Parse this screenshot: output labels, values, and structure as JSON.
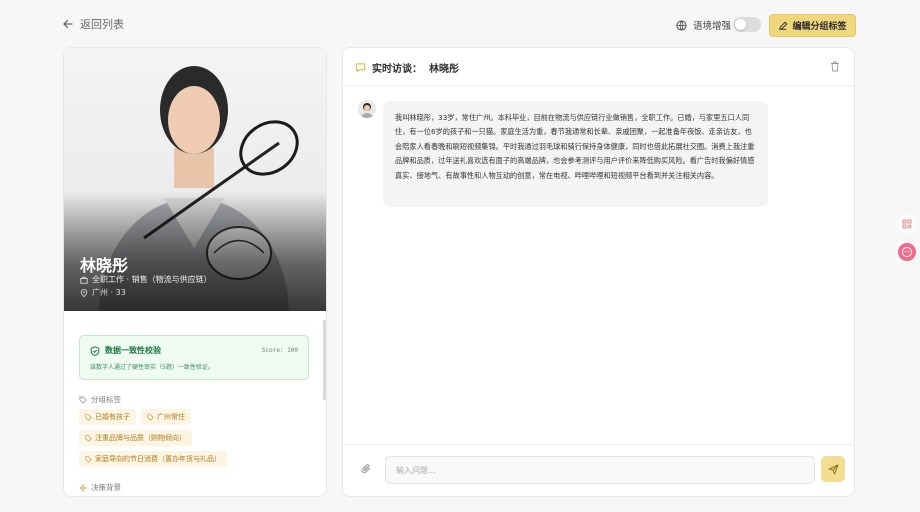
{
  "topbar": {
    "back_label": "返回列表",
    "lang_label": "语境增强",
    "edit_label": "编辑分组标签"
  },
  "profile": {
    "name": "林晓彤",
    "job": "全职工作 · 销售（物流与供应链）",
    "location": "广州 · 33"
  },
  "verify": {
    "title": "数据一致性校验",
    "score": "Score: 100",
    "desc": "该数字人通过了硬性审实（5题）一致性验证。"
  },
  "groups": {
    "label": "分组标签",
    "tags": [
      "已婚有孩子",
      "广州常住",
      "注重品牌与品质（购物倾向）",
      "家庭导向的节日消费（置办年货与礼品）"
    ]
  },
  "decision": {
    "label": "决策背景"
  },
  "chat": {
    "title": "实时访谈：  林晓彤",
    "message": "我叫林晓彤，33岁，常住广州。本科毕业，目前在物流与供应链行业做销售，全职工作。已婚，与家里五口人同住，有一位6岁的孩子和一只猫。家庭生活为重，春节我通常和长辈、亲戚团聚，一起准备年夜饭、走亲访友，也会陪家人看春晚和刷短视频集锦。平时我通过羽毛球和骑行保持身体健康，同时也借此拓展社交圈。消费上我注重品牌和品质，过年送礼喜欢选有面子的高端品牌，也会参考测评与用户评价来降低购买风险。看广告时我偏好情感真实、接地气、有故事性和人物互动的创意，常在电视、哔哩哔哩和短视频平台看到并关注相关内容。",
    "placeholder": "输入问题..."
  },
  "icons": {
    "back": "arrow-left-icon",
    "globe": "globe-icon",
    "pencil": "pencil-icon",
    "shield": "shield-check-icon",
    "tag": "tag-icon",
    "chat": "chat-icon",
    "trash": "trash-icon",
    "clip": "paperclip-icon",
    "send": "send-icon",
    "briefcase": "briefcase-icon",
    "pin": "location-pin-icon"
  },
  "colors": {
    "accent": "#f0d77e",
    "success": "#1f7a45",
    "tag_text": "#b27a1c"
  }
}
